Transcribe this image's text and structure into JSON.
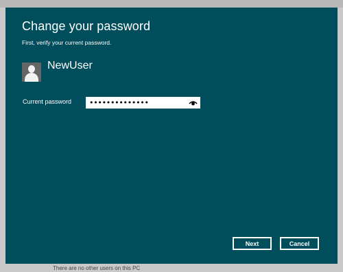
{
  "dialog": {
    "title": "Change your password",
    "subtitle": "First, verify your current password.",
    "username": "NewUser",
    "password_label": "Current password",
    "password_value": "••••••••••••••",
    "next_label": "Next",
    "cancel_label": "Cancel"
  },
  "background": {
    "bottom_text": "There are no other users on this PC"
  },
  "icons": [
    "user-avatar-icon",
    "reveal-password-eye-icon"
  ],
  "colors": {
    "dialog_bg": "#004d5c",
    "text": "#ffffff"
  }
}
